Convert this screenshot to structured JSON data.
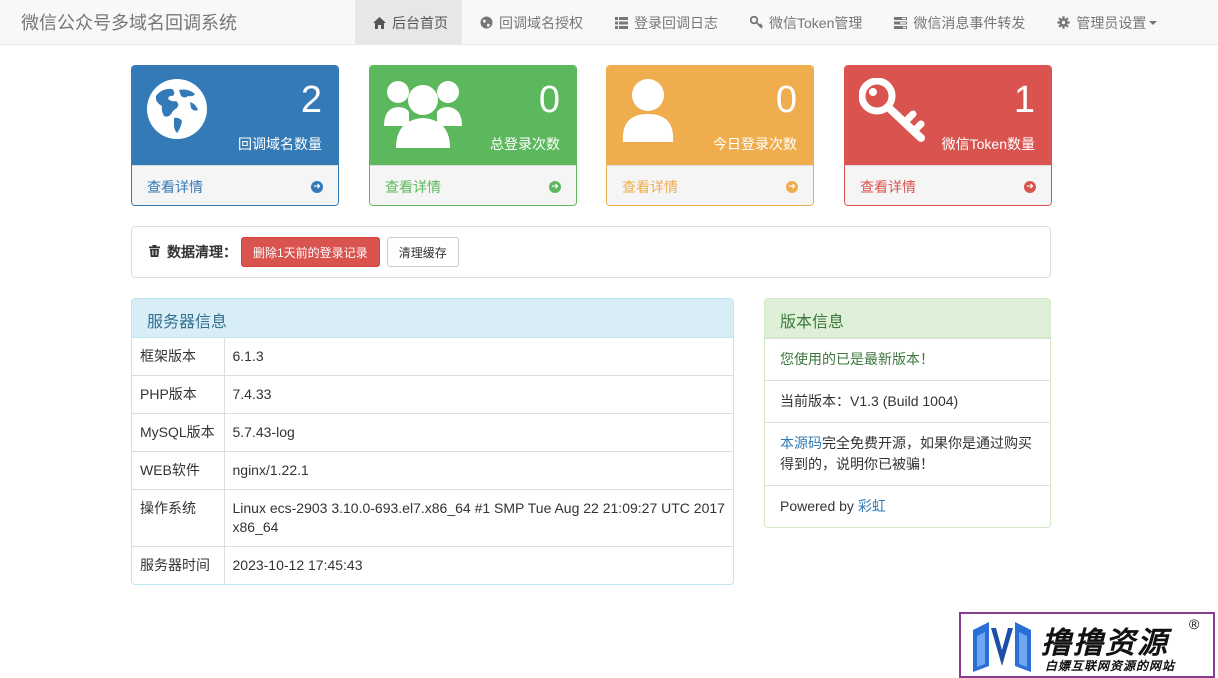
{
  "brand": "微信公众号多域名回调系统",
  "nav": [
    {
      "label": "后台首页",
      "icon": "home-icon"
    },
    {
      "label": "回调域名授权",
      "icon": "globe-icon"
    },
    {
      "label": "登录回调日志",
      "icon": "list-icon"
    },
    {
      "label": "微信Token管理",
      "icon": "key-icon"
    },
    {
      "label": "微信消息事件转发",
      "icon": "tasks-icon"
    },
    {
      "label": "管理员设置",
      "icon": "gear-icon"
    }
  ],
  "stats": [
    {
      "value": "2",
      "label": "回调域名数量",
      "link": "查看详情",
      "color": "#337ab7",
      "icon": "globe-icon"
    },
    {
      "value": "0",
      "label": "总登录次数",
      "link": "查看详情",
      "color": "#5cb85c",
      "icon": "users-icon"
    },
    {
      "value": "0",
      "label": "今日登录次数",
      "link": "查看详情",
      "color": "#f0ad4e",
      "icon": "user-icon"
    },
    {
      "value": "1",
      "label": "微信Token数量",
      "link": "查看详情",
      "color": "#d9534f",
      "icon": "key-icon"
    }
  ],
  "cleanup": {
    "title": "数据清理：",
    "delete_button": "删除1天前的登录记录",
    "cache_button": "清理缓存"
  },
  "server": {
    "title": "服务器信息",
    "rows": [
      {
        "key": "框架版本",
        "value": "6.1.3"
      },
      {
        "key": "PHP版本",
        "value": "7.4.33"
      },
      {
        "key": "MySQL版本",
        "value": "5.7.43-log"
      },
      {
        "key": "WEB软件",
        "value": "nginx/1.22.1"
      },
      {
        "key": "操作系统",
        "value": "Linux ecs-2903 3.10.0-693.el7.x86_64 #1 SMP Tue Aug 22 21:09:27 UTC 2017 x86_64"
      },
      {
        "key": "服务器时间",
        "value": "2023-10-12 17:45:43"
      }
    ]
  },
  "version": {
    "title": "版本信息",
    "latest": "您使用的已是最新版本！",
    "current": "当前版本：V1.3 (Build 1004)",
    "source_link": "本源码",
    "source_text": "完全免费开源，如果你是通过购买得到的，说明你已被骗！",
    "powered_prefix": "Powered by ",
    "powered_link": "彩虹"
  },
  "watermark": {
    "title": "撸撸资源",
    "reg": "®",
    "subtitle": "白嫖互联网资源的网站"
  }
}
